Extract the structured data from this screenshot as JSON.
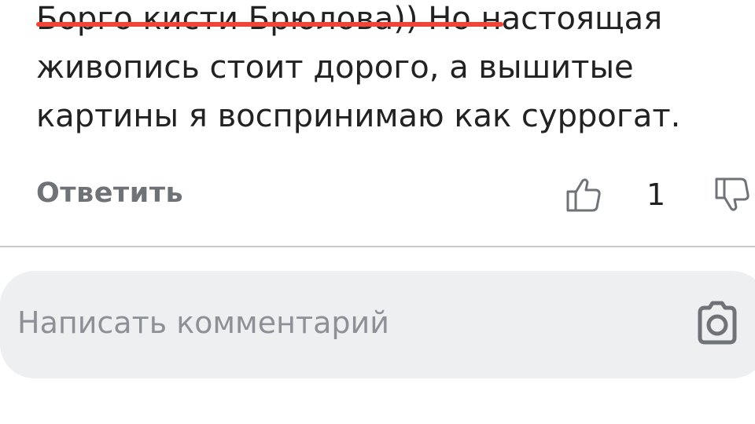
{
  "comment": {
    "text": "Борго кисти Брюлова)) Но настоящая\nживопись стоит дорого, а вышитые\nкартины я воспринимаю как суррогат.",
    "strikethrough_color": "#f04438"
  },
  "actions": {
    "reply_label": "Ответить",
    "like_count": "1",
    "like_icon": "thumbs-up-icon",
    "dislike_icon": "thumbs-down-icon"
  },
  "composer": {
    "placeholder": "Написать комментарий",
    "camera_icon": "camera-icon"
  }
}
